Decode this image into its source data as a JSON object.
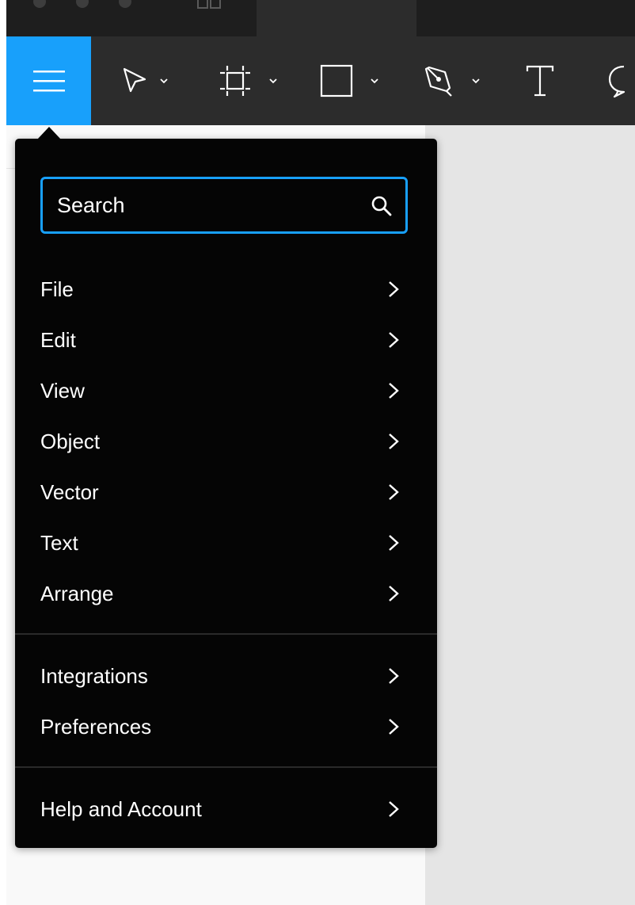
{
  "colors": {
    "accent": "#18a0fb",
    "toolbar": "#2c2c2c",
    "menu_bg": "#050505",
    "canvas": "#e5e5e5"
  },
  "toolbar": {
    "main_menu_icon": "hamburger-icon",
    "tools": [
      {
        "name": "move-tool",
        "icon": "cursor-arrow-icon",
        "has_dropdown": true
      },
      {
        "name": "frame-tool",
        "icon": "frame-icon",
        "has_dropdown": true
      },
      {
        "name": "shape-tool",
        "icon": "rectangle-icon",
        "has_dropdown": true
      },
      {
        "name": "pen-tool",
        "icon": "pen-icon",
        "has_dropdown": true
      },
      {
        "name": "text-tool",
        "icon": "text-icon",
        "has_dropdown": false
      },
      {
        "name": "comment-tool",
        "icon": "comment-icon",
        "has_dropdown": false
      }
    ]
  },
  "menu": {
    "search": {
      "placeholder": "Search",
      "value": "",
      "icon": "search-icon"
    },
    "groups": [
      {
        "items": [
          {
            "label": "File",
            "icon": "chevron-right-icon"
          },
          {
            "label": "Edit",
            "icon": "chevron-right-icon"
          },
          {
            "label": "View",
            "icon": "chevron-right-icon"
          },
          {
            "label": "Object",
            "icon": "chevron-right-icon"
          },
          {
            "label": "Vector",
            "icon": "chevron-right-icon"
          },
          {
            "label": "Text",
            "icon": "chevron-right-icon"
          },
          {
            "label": "Arrange",
            "icon": "chevron-right-icon"
          }
        ]
      },
      {
        "items": [
          {
            "label": "Integrations",
            "icon": "chevron-right-icon"
          },
          {
            "label": "Preferences",
            "icon": "chevron-right-icon"
          }
        ]
      },
      {
        "items": [
          {
            "label": "Help and Account",
            "icon": "chevron-right-icon"
          }
        ]
      }
    ]
  }
}
